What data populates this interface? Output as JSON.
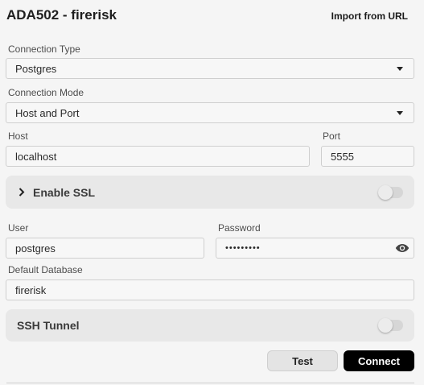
{
  "header": {
    "title": "ADA502 - firerisk",
    "import_label": "Import from URL"
  },
  "connection_type": {
    "label": "Connection Type",
    "value": "Postgres"
  },
  "connection_mode": {
    "label": "Connection Mode",
    "value": "Host and Port"
  },
  "host": {
    "label": "Host",
    "value": "localhost"
  },
  "port": {
    "label": "Port",
    "value": "5555"
  },
  "ssl": {
    "label": "Enable SSL",
    "enabled": false
  },
  "user": {
    "label": "User",
    "value": "postgres"
  },
  "password": {
    "label": "Password",
    "masked_value": "•••••••••"
  },
  "default_database": {
    "label": "Default Database",
    "value": "firerisk"
  },
  "ssh_tunnel": {
    "label": "SSH Tunnel",
    "enabled": false
  },
  "actions": {
    "test_label": "Test",
    "connect_label": "Connect"
  },
  "icons": {
    "dropdown": "caret-down-icon",
    "expand": "chevron-right-icon",
    "reveal_password": "eye-icon"
  },
  "colors": {
    "primary_button_bg": "#000000",
    "primary_button_text": "#ffffff",
    "section_bg": "#e8e8e8",
    "page_bg": "#f5f5f5"
  }
}
